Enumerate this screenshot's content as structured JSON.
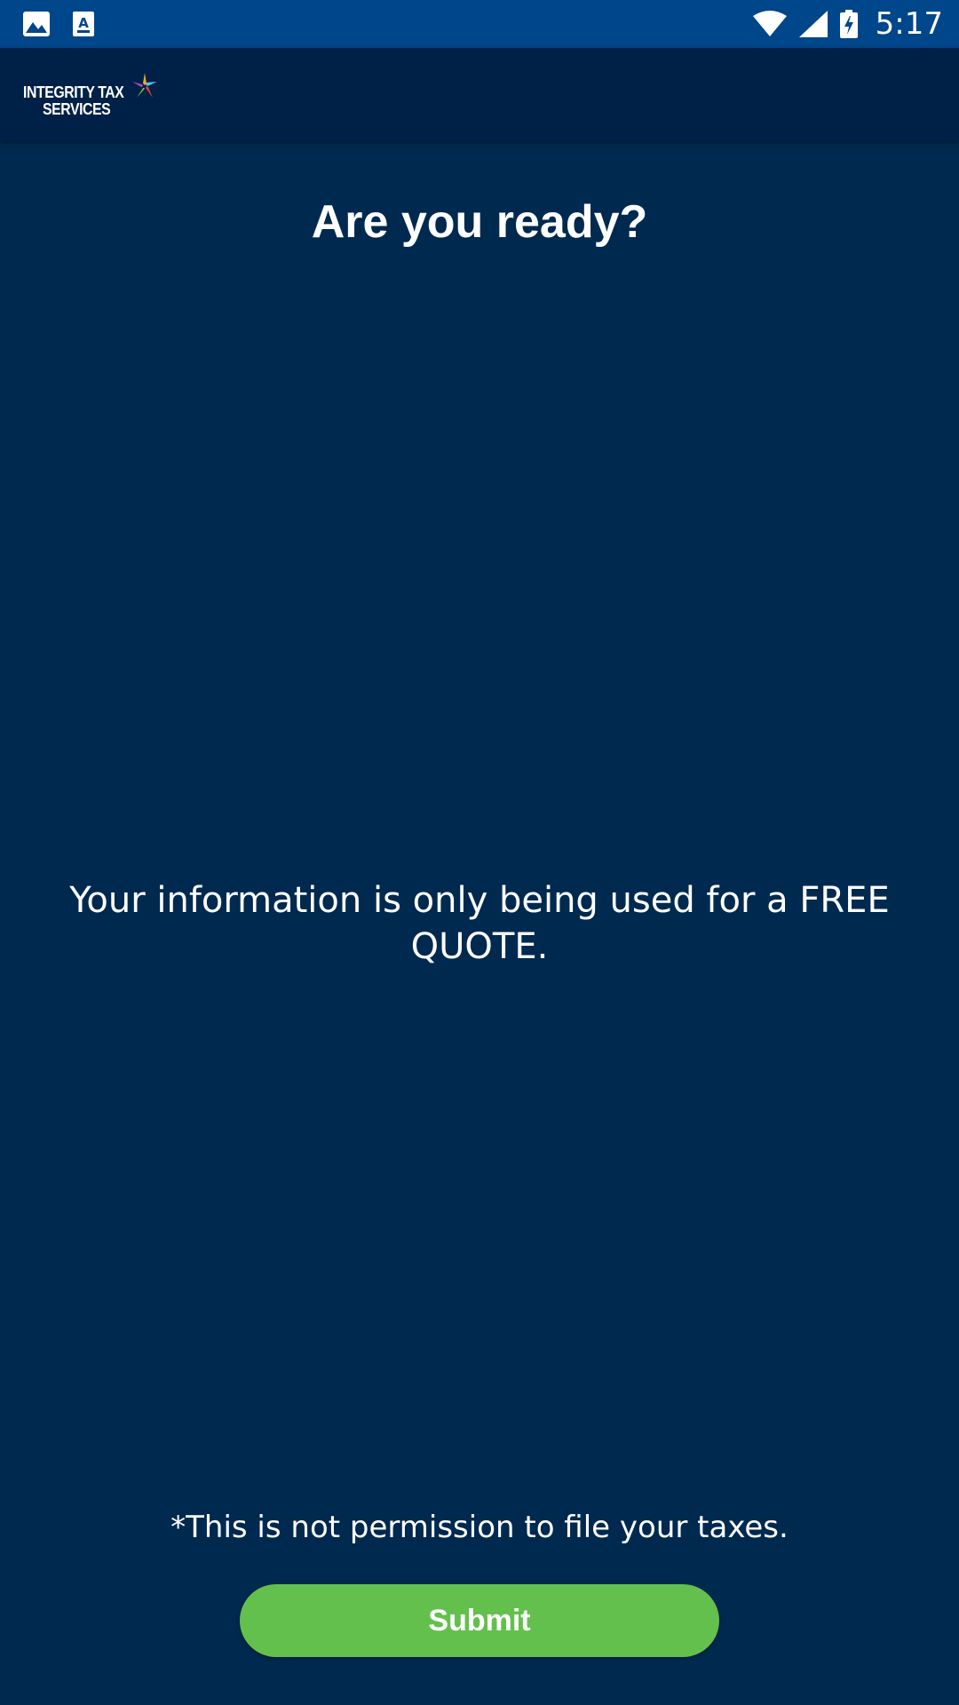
{
  "status_bar": {
    "time": "5:17",
    "icons": [
      "gallery-icon",
      "text-app-icon",
      "wifi-icon",
      "cell-signal-icon",
      "battery-charging-icon"
    ]
  },
  "app_bar": {
    "logo_line1": "INTEGRITY TAX",
    "logo_line2": "SERVICES"
  },
  "main": {
    "heading": "Are you ready?",
    "info": "Your information is only being used for a FREE QUOTE.",
    "disclaimer": "*This is not permission to file your taxes.",
    "submit_label": "Submit"
  },
  "colors": {
    "background": "#00294f",
    "status_bar": "#00468a",
    "app_bar": "#002147",
    "button": "#64c04c"
  }
}
